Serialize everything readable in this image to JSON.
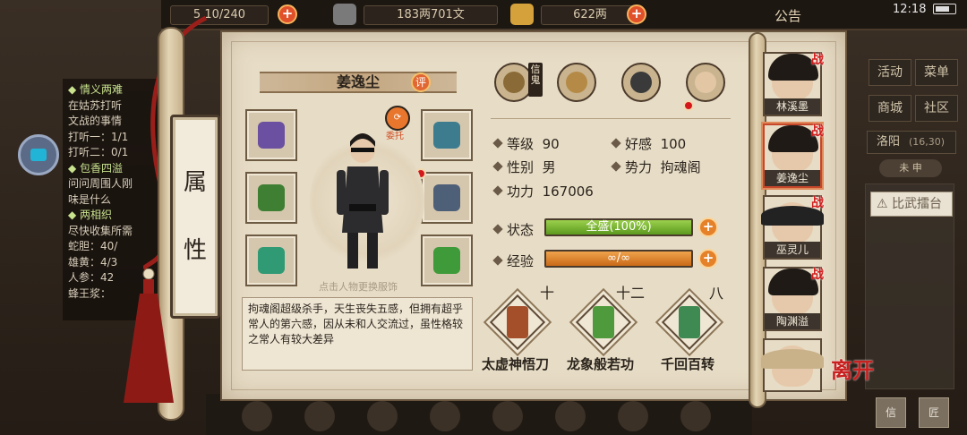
{
  "topbar": {
    "resource1": "5 10/240",
    "resource2": "183两701文",
    "resource3": "622两",
    "notice": "公告",
    "time": "12:18"
  },
  "quest_panel": {
    "lines": [
      {
        "text": "◆ 情义两难",
        "type": "h"
      },
      {
        "text": "在姑苏打听",
        "type": "t"
      },
      {
        "text": "文战的事情",
        "type": "t"
      },
      {
        "text": "打听一：1/1",
        "type": "p"
      },
      {
        "text": "打听二：0/1",
        "type": "p"
      },
      {
        "text": "◆ 包香四溢",
        "type": "h"
      },
      {
        "text": "问问周围人刚",
        "type": "t"
      },
      {
        "text": "味是什么",
        "type": "t"
      },
      {
        "text": "◆ 两相织",
        "type": "h"
      },
      {
        "text": "尽快收集所需",
        "type": "t"
      },
      {
        "text": "蛇胆：40/",
        "type": "p"
      },
      {
        "text": "雄黄：4/3",
        "type": "p"
      },
      {
        "text": "人参：42",
        "type": "p"
      },
      {
        "text": "蜂王浆：",
        "type": "p"
      }
    ]
  },
  "right_menu": {
    "activity": "活动",
    "menu": "菜单",
    "shop": "商城",
    "community": "社区",
    "location": "洛阳",
    "coords": "(16,30)",
    "compass": "未 申",
    "arena": "比武擂台",
    "btn1": "信",
    "btn2": "匠"
  },
  "scroll": {
    "banner_char1": "属",
    "banner_char2": "性"
  },
  "character": {
    "name": "姜逸尘",
    "review_label": "评",
    "outfit_label": "委托",
    "change_hint": "点击人物更换服饰",
    "description": "拘魂阁超级杀手，天生丧失五感，但拥有超乎常人的第六感，因从未和人交流过，虽性格较之常人有较大差异",
    "xinqu_label": "信鬼"
  },
  "stats": {
    "level_label": "等级",
    "level_value": "90",
    "favor_label": "好感",
    "favor_value": "100",
    "gender_label": "性别",
    "gender_value": "男",
    "faction_label": "势力",
    "faction_value": "拘魂阁",
    "power_label": "功力",
    "power_value": "167006",
    "status_label": "状态",
    "status_value": "全盛(100%)",
    "status_fill": 1.0,
    "exp_label": "经验",
    "exp_value": "∞/∞",
    "exp_fill": 1.0
  },
  "skills": [
    {
      "level": "十",
      "name": "太虚神悟刀",
      "color": "#a44f2a"
    },
    {
      "level": "十二",
      "name": "龙象般若功",
      "color": "#4f9a3c"
    },
    {
      "level": "八",
      "name": "千回百转",
      "color": "#3e8a52"
    }
  ],
  "equipment": [
    {
      "name": "gauntlets-icon",
      "color": "#6b4fa0"
    },
    {
      "name": "hat-icon",
      "color": "#3d7c8e"
    },
    {
      "name": "sword-icon",
      "color": "#3f7f33"
    },
    {
      "name": "armor-icon",
      "color": "#4e5f78"
    },
    {
      "name": "jade-ring-icon",
      "color": "#2f9a74"
    },
    {
      "name": "pendant-icon",
      "color": "#3f9a3a"
    }
  ],
  "characters": [
    {
      "name": "林溪墨",
      "badge": "战"
    },
    {
      "name": "姜逸尘",
      "badge": "战"
    },
    {
      "name": "巫灵儿",
      "badge": "战"
    },
    {
      "name": "陶渊溢",
      "badge": "战"
    },
    {
      "name": "",
      "badge": ""
    }
  ],
  "leave_label": "离开"
}
